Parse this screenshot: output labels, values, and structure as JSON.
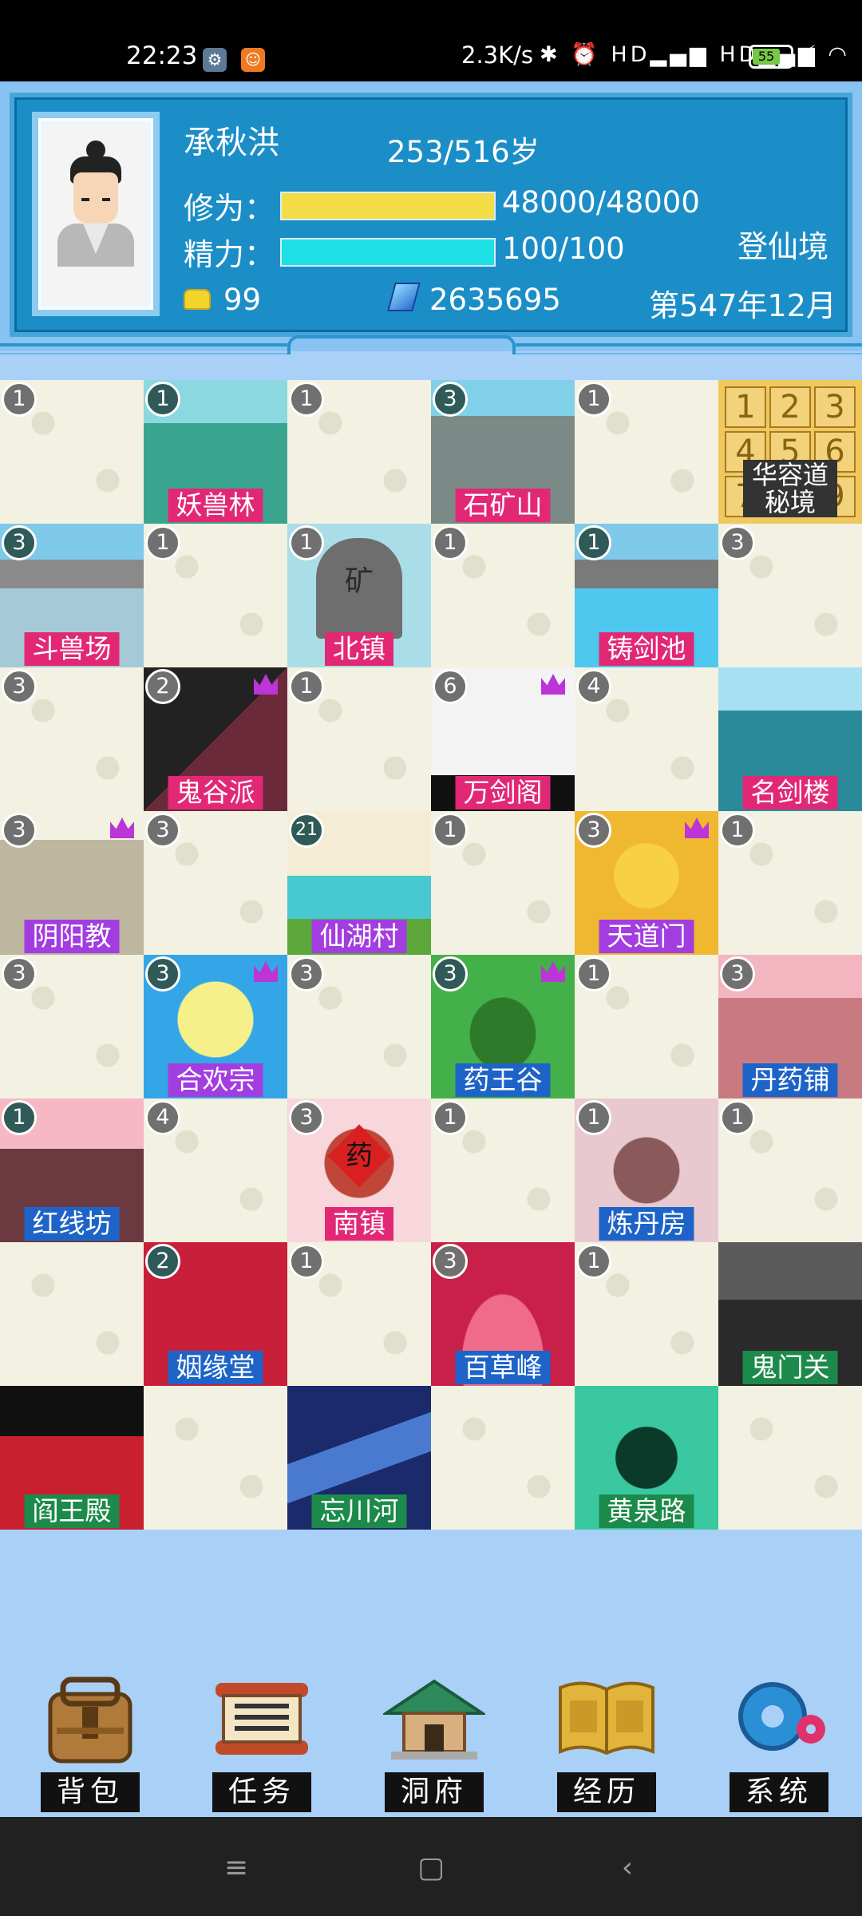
{
  "status_bar": {
    "time": "22:23",
    "gear_glyph": "⚙",
    "app_glyph": "☺",
    "net_speed": "2.3K/s",
    "sys_icons": "✱ ⏰ HD▂▄▆ HD▂▄▆ ◠",
    "battery": "55",
    "charging_glyph": "⚡"
  },
  "player": {
    "name": "承秋洪",
    "age": "253/516岁",
    "cultivation_label": "修为：",
    "cultivation_value": "48000/48000",
    "cultivation_fraction": 1.0,
    "energy_label": "精力：",
    "energy_value": "100/100",
    "energy_fraction": 1.0,
    "realm": "登仙境",
    "gold": "99",
    "spirit_stones": "2635695",
    "date": "第547年12月"
  },
  "colors": {
    "cultivation_bar": "#f3dc45",
    "energy_bar": "#1fe0e4"
  },
  "map_cells": [
    {
      "badge": "1"
    },
    {
      "badge": "1",
      "name": "妖兽林",
      "label_color": "pink",
      "art": "forest",
      "badge_dark": true
    },
    {
      "badge": "1"
    },
    {
      "badge": "3",
      "name": "石矿山",
      "label_color": "pink",
      "art": "mountain",
      "badge_dark": true
    },
    {
      "badge": "1"
    },
    {
      "name": "华容道\n秘境",
      "label_color": "dark",
      "art": "puzzle",
      "puzzle_digits": [
        "1",
        "2",
        "3",
        "4",
        "5",
        "6",
        "7",
        "8",
        "9"
      ]
    },
    {
      "badge": "3",
      "name": "斗兽场",
      "label_color": "pink",
      "art": "arena",
      "badge_dark": true
    },
    {
      "badge": "1"
    },
    {
      "badge": "1",
      "name": "北镇",
      "label_color": "pink",
      "art": "stone",
      "stone_text": "矿"
    },
    {
      "badge": "1"
    },
    {
      "badge": "1",
      "name": "铸剑池",
      "label_color": "pink",
      "art": "pool",
      "badge_dark": true
    },
    {
      "badge": "3"
    },
    {
      "badge": "3"
    },
    {
      "badge": "2",
      "name": "鬼谷派",
      "label_color": "pink",
      "art": "sword",
      "crown": true
    },
    {
      "badge": "1"
    },
    {
      "badge": "6",
      "name": "万剑阁",
      "label_color": "pink",
      "art": "swords",
      "crown": true
    },
    {
      "badge": "4"
    },
    {
      "name": "名剑楼",
      "label_color": "pink",
      "art": "pagoda"
    },
    {
      "badge": "3",
      "name": "阴阳教",
      "label_color": "purple",
      "art": "fortress",
      "crown": true
    },
    {
      "badge": "3"
    },
    {
      "badge": "21",
      "name": "仙湖村",
      "label_color": "purple",
      "art": "village",
      "badge_dark": true
    },
    {
      "badge": "1"
    },
    {
      "badge": "3",
      "name": "天道门",
      "label_color": "purple",
      "art": "taiji",
      "crown": true
    },
    {
      "badge": "1"
    },
    {
      "badge": "3"
    },
    {
      "badge": "3",
      "name": "合欢宗",
      "label_color": "purple",
      "art": "meditate",
      "crown": true,
      "badge_dark": true
    },
    {
      "badge": "3"
    },
    {
      "badge": "3",
      "name": "药王谷",
      "label_color": "blue",
      "art": "gourd",
      "crown": true,
      "badge_dark": true
    },
    {
      "badge": "1"
    },
    {
      "badge": "3",
      "name": "丹药铺",
      "label_color": "blue",
      "art": "shop"
    },
    {
      "badge": "1",
      "name": "红线坊",
      "label_color": "blue",
      "art": "street",
      "badge_dark": true
    },
    {
      "badge": "4"
    },
    {
      "badge": "3",
      "name": "南镇",
      "label_color": "pink",
      "art": "jar",
      "jar_text": "药"
    },
    {
      "badge": "1"
    },
    {
      "badge": "1",
      "name": "炼丹房",
      "label_color": "blue",
      "art": "cauldron"
    },
    {
      "badge": "1"
    },
    {},
    {
      "badge": "2",
      "name": "姻缘堂",
      "label_color": "blue",
      "art": "wedding",
      "badge_dark": true
    },
    {
      "badge": "1"
    },
    {
      "badge": "3",
      "name": "百草峰",
      "label_color": "blue",
      "art": "redpeak"
    },
    {
      "badge": "1"
    },
    {
      "name": "鬼门关",
      "label_color": "green",
      "art": "gate"
    },
    {
      "name": "阎王殿",
      "label_color": "green",
      "art": "palace"
    },
    {},
    {
      "name": "忘川河",
      "label_color": "green",
      "art": "river"
    },
    {},
    {
      "name": "黄泉路",
      "label_color": "green",
      "art": "underworld"
    },
    {}
  ],
  "dock": [
    {
      "label": "背包",
      "icon": "backpack-icon"
    },
    {
      "label": "任务",
      "icon": "scroll-icon"
    },
    {
      "label": "洞府",
      "icon": "pavilion-icon"
    },
    {
      "label": "经历",
      "icon": "book-icon"
    },
    {
      "label": "系统",
      "icon": "gear-icon"
    }
  ],
  "nav": {
    "menu_glyph": "≡",
    "home_glyph": "▢",
    "back_glyph": "‹"
  }
}
